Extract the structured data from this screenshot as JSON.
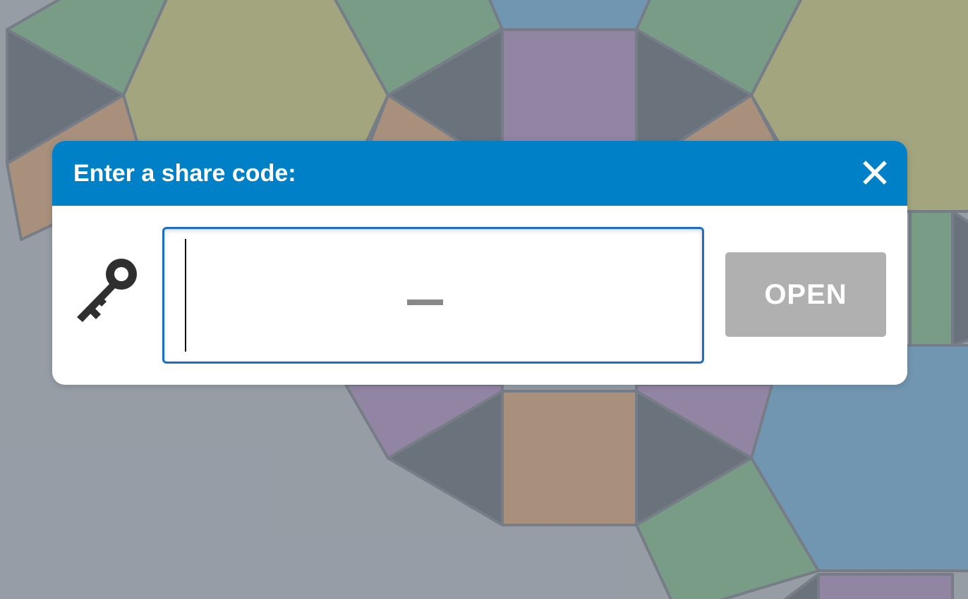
{
  "dialog": {
    "title": "Enter a share code:",
    "close_icon": "close-icon",
    "key_icon": "key-icon",
    "code_input": {
      "value": "",
      "placeholder": "–"
    },
    "open_button": {
      "label": "OPEN",
      "enabled": false
    }
  },
  "colors": {
    "header": "#0080c6",
    "dialog_bg": "#ffffff",
    "input_border": "#1c6fc4",
    "button_disabled": "#b0b0b0",
    "scrim": "#8a929b"
  }
}
